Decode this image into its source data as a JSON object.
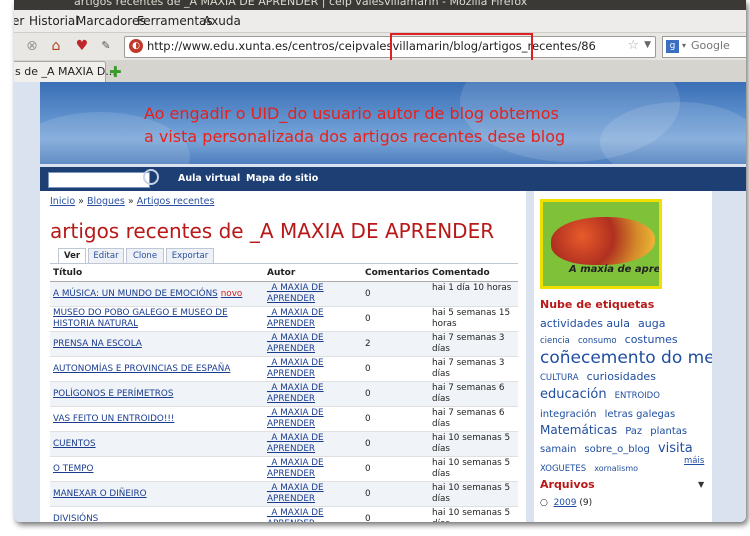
{
  "window": {
    "title_fragment": "artigos recentes de _A MAXIA DE APRENDER | ceip valesvillamarín - Mozilla Firefox"
  },
  "menu": [
    "er",
    "Historial",
    "Marcadores",
    "Ferramentas",
    "Axuda"
  ],
  "urlbar": {
    "url": "http://www.edu.xunta.es/centros/ceipvalesvillamarin/blog/artigos_recentes/86"
  },
  "search": {
    "placeholder": "Google"
  },
  "tab": {
    "label": "s de _A MAXIA D..."
  },
  "annotation": {
    "line1": "Ao engadir o UID_do usuario autor de blog obtemos",
    "line2": "a vista personalizada dos artigos recentes dese blog"
  },
  "sitenav": {
    "aula_virtual": "Aula virtual",
    "mapa": "Mapa do sitio"
  },
  "breadcrumb": {
    "inicio": "Inicio",
    "sep": "»",
    "blogues": "Blogues",
    "artigos": "Artigos recentes"
  },
  "page_title": "artigos recentes de _A MAXIA DE APRENDER",
  "page_tabs": [
    "Ver",
    "Editar",
    "Clone",
    "Exportar"
  ],
  "table": {
    "headers": [
      "Título",
      "Autor",
      "Comentarios",
      "Comentado"
    ],
    "rows": [
      {
        "title": "A MÚSICA: UN MUNDO DE EMOCIÓNS",
        "new": "novo",
        "author": "_A MAXIA DE APRENDER",
        "comments": "0",
        "when": "hai 1 día 10 horas"
      },
      {
        "title": "MUSEO DO POBO GALEGO E MUSEO DE HISTORIA NATURAL",
        "new": "",
        "author": "_A MAXIA DE APRENDER",
        "comments": "0",
        "when": "hai 5 semanas 15 horas"
      },
      {
        "title": "PRENSA NA ESCOLA",
        "new": "",
        "author": "_A MAXIA DE APRENDER",
        "comments": "2",
        "when": "hai 7 semanas 3 días"
      },
      {
        "title": "AUTONOMÍAS E PROVINCIAS DE ESPAÑA",
        "new": "",
        "author": "_A MAXIA DE APRENDER",
        "comments": "0",
        "when": "hai 7 semanas 3 días"
      },
      {
        "title": "POLÍGONOS E PERÍMETROS",
        "new": "",
        "author": "_A MAXIA DE APRENDER",
        "comments": "0",
        "when": "hai 7 semanas 6 días"
      },
      {
        "title": "VAS FEITO UN ENTROIDO!!!",
        "new": "",
        "author": "_A MAXIA DE APRENDER",
        "comments": "0",
        "when": "hai 7 semanas 6 días"
      },
      {
        "title": "CUENTOS",
        "new": "",
        "author": "_A MAXIA DE APRENDER",
        "comments": "0",
        "when": "hai 10 semanas 5 días"
      },
      {
        "title": "O TEMPO",
        "new": "",
        "author": "_A MAXIA DE APRENDER",
        "comments": "0",
        "when": "hai 10 semanas 5 días"
      },
      {
        "title": "MANEXAR O DIÑEIRO",
        "new": "",
        "author": "_A MAXIA DE APRENDER",
        "comments": "0",
        "when": "hai 10 semanas 5 días"
      },
      {
        "title": "DIVISIÓNS",
        "new": "",
        "author": "_A MAXIA DE APRENDER",
        "comments": "0",
        "when": "hai 10 semanas 5 días"
      }
    ]
  },
  "sidebar": {
    "logo_text": "A maxia de aprender !!!",
    "tags_title": "Nube de etiquetas",
    "tags": [
      {
        "text": "actividades aula",
        "size": 11
      },
      {
        "text": "auga",
        "size": 11
      },
      {
        "text": "ciencia",
        "size": 8.5
      },
      {
        "text": "consumo",
        "size": 8.5
      },
      {
        "text": "costumes",
        "size": 11
      },
      {
        "text": "coñecemento do medio",
        "size": 17
      },
      {
        "text": "CULTURA",
        "size": 8.5
      },
      {
        "text": "curiosidades",
        "size": 11
      },
      {
        "text": "educación",
        "size": 13
      },
      {
        "text": "ENTROIDO",
        "size": 8.5
      },
      {
        "text": "integración",
        "size": 10
      },
      {
        "text": "letras galegas",
        "size": 10
      },
      {
        "text": "Matemáticas",
        "size": 12
      },
      {
        "text": "Paz",
        "size": 10
      },
      {
        "text": "plantas",
        "size": 10
      },
      {
        "text": "samain",
        "size": 10
      },
      {
        "text": "sobre_o_blog",
        "size": 10
      },
      {
        "text": "visita",
        "size": 13
      },
      {
        "text": "XOGUETES",
        "size": 8.5
      },
      {
        "text": "xornalismo",
        "size": 8
      }
    ],
    "mais": "máis",
    "arquivos_title": "Arquivos",
    "arquivo_year": "2009",
    "arquivo_count": "(9)"
  },
  "colors": {
    "annotation": "#e8201a",
    "title": "#b81818",
    "link": "#1a3c8f",
    "nav": "#1d3f74"
  }
}
